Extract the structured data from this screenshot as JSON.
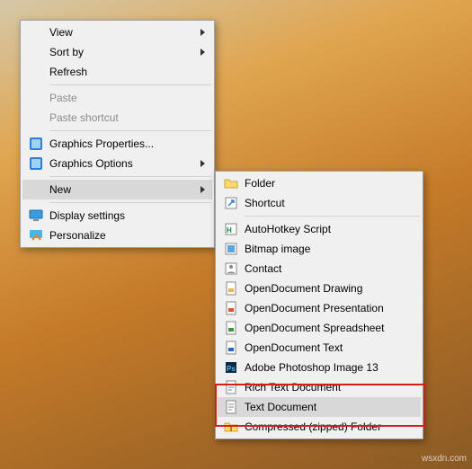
{
  "watermark": "wsxdn.com",
  "primary": {
    "view": "View",
    "sort": "Sort by",
    "refresh": "Refresh",
    "paste": "Paste",
    "paste_shortcut": "Paste shortcut",
    "gprops": "Graphics Properties...",
    "gopts": "Graphics Options",
    "new": "New",
    "display": "Display settings",
    "personalize": "Personalize"
  },
  "secondary": {
    "folder": "Folder",
    "shortcut": "Shortcut",
    "ahk": "AutoHotkey Script",
    "bmp": "Bitmap image",
    "contact": "Contact",
    "odg": "OpenDocument Drawing",
    "odp": "OpenDocument Presentation",
    "ods": "OpenDocument Spreadsheet",
    "odt": "OpenDocument Text",
    "psd": "Adobe Photoshop Image 13",
    "rtf": "Rich Text Document",
    "txt": "Text Document",
    "zip": "Compressed (zipped) Folder"
  }
}
